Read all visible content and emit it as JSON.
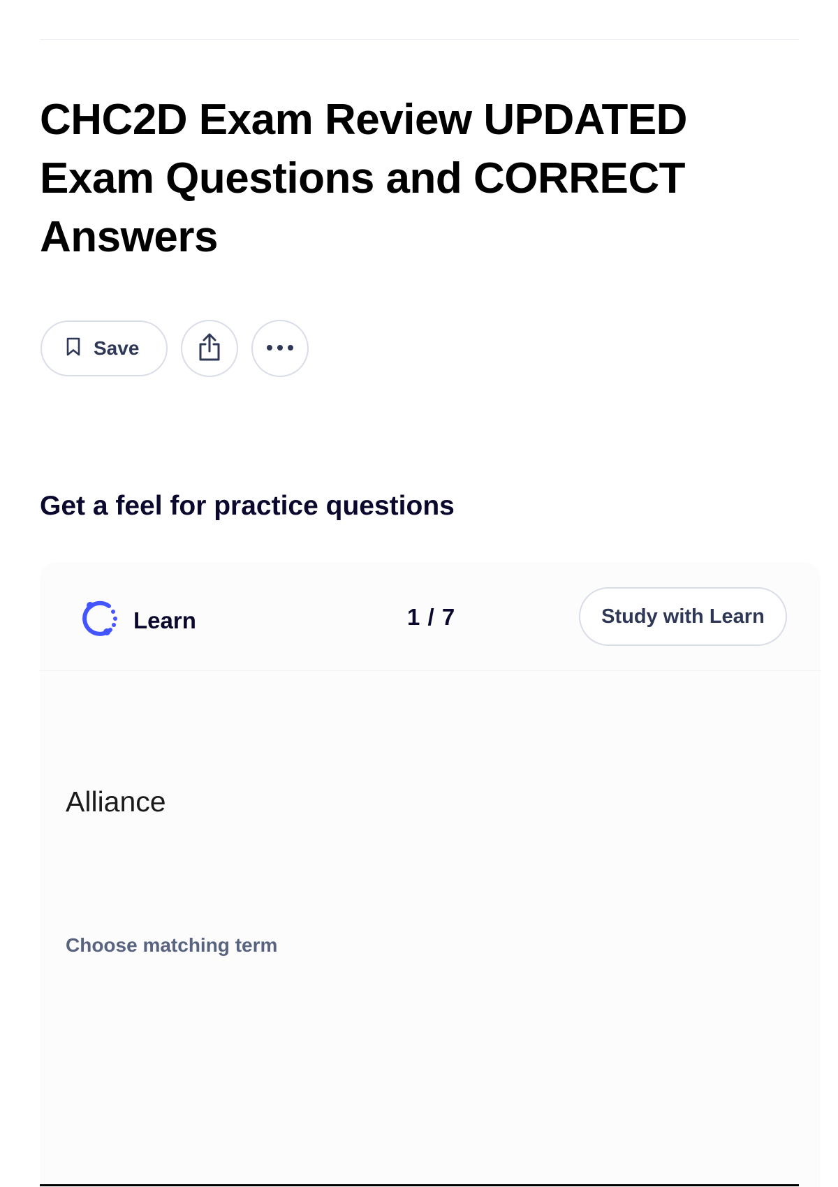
{
  "page": {
    "title": "CHC2D Exam Review UPDATED Exam Questions and CORRECT Answers"
  },
  "actions": {
    "save_label": "Save",
    "save_icon": "bookmark-icon",
    "share_icon": "share-icon",
    "more_icon": "more-horizontal-icon"
  },
  "practice": {
    "heading": "Get a feel for practice questions",
    "learn_label": "Learn",
    "learn_icon": "learn-mode-icon",
    "progress": "1 / 7",
    "study_button": "Study with Learn",
    "term": "Alliance",
    "instruction": "Choose matching term"
  },
  "colors": {
    "accent": "#4255ff",
    "text_primary": "#0a092d",
    "text_secondary": "#586380",
    "border": "#d9dde8"
  }
}
